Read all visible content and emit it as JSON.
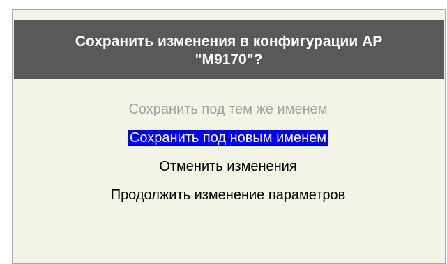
{
  "dialog": {
    "title_line1": "Сохранить изменения в конфигурации АР",
    "title_line2": "\"M9170\"?"
  },
  "menu": {
    "items": [
      {
        "label": "Сохранить под тем же именем",
        "state": "disabled"
      },
      {
        "label": "Сохранить под новым именем",
        "state": "selected"
      },
      {
        "label": "Отменить изменения",
        "state": "normal"
      },
      {
        "label": "Продолжить изменение параметров",
        "state": "normal"
      }
    ]
  },
  "colors": {
    "dialog_background": "#f4f4e6",
    "title_background": "#595959",
    "selection_background": "#0000ff",
    "disabled_text": "#a0a0a0"
  }
}
